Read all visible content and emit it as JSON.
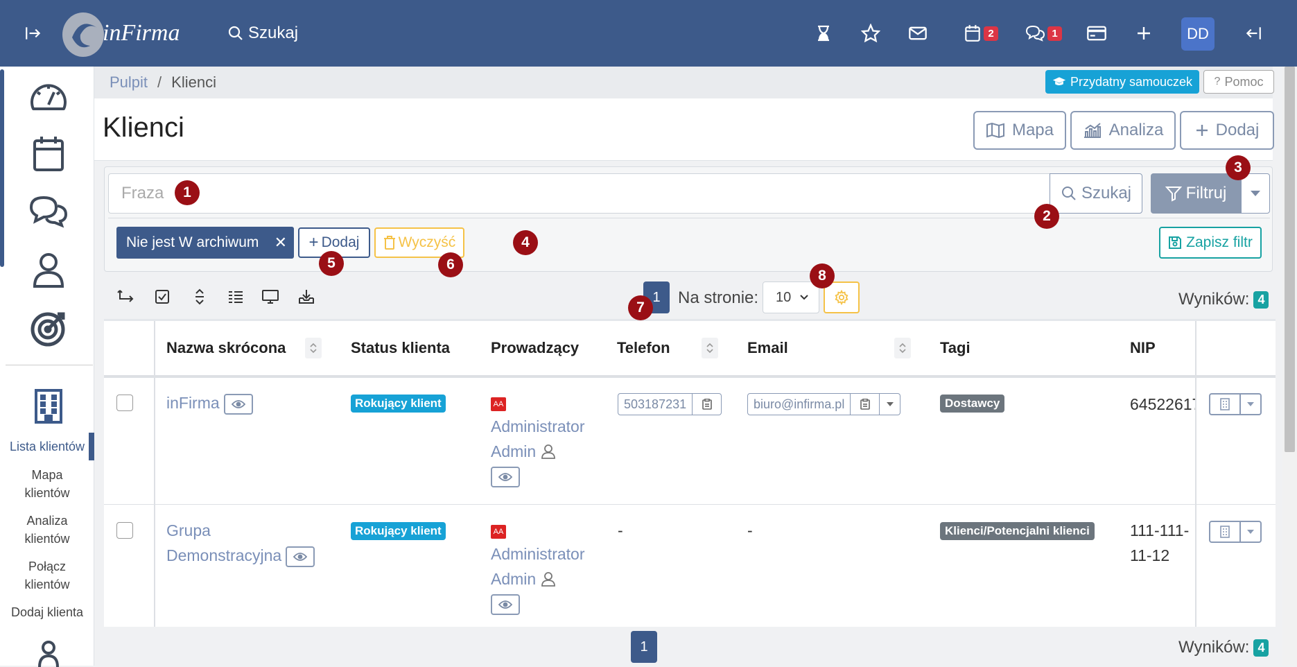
{
  "topbar": {
    "search_label": "Szukaj",
    "calendar_badge": "2",
    "chat_badge": "1",
    "avatar": "DD",
    "logo_text": "inFirma"
  },
  "sidebar": {
    "links": [
      "Lista klientów",
      "Mapa klientów",
      "Analiza klientów",
      "Połącz klientów",
      "Dodaj klienta"
    ],
    "link_lines": [
      [
        "Lista klientów"
      ],
      [
        "Mapa",
        "klientów"
      ],
      [
        "Analiza",
        "klientów"
      ],
      [
        "Połącz",
        "klientów"
      ],
      [
        "Dodaj klienta"
      ]
    ]
  },
  "breadcrumb": {
    "home": "Pulpit",
    "sep": "/",
    "current": "Klienci"
  },
  "help": {
    "tutorial": "Przydatny samouczek",
    "help": "Pomoc"
  },
  "page": {
    "title": "Klienci"
  },
  "header_buttons": {
    "map": "Mapa",
    "analysis": "Analiza",
    "add": "Dodaj"
  },
  "filter": {
    "phrase_placeholder": "Fraza",
    "search": "Szukaj",
    "filter": "Filtruj",
    "active_chip": "Nie jest W archiwum",
    "add": "Dodaj",
    "clear": "Wyczyść",
    "save": "Zapisz filtr"
  },
  "pagination": {
    "page": "1",
    "per_page_label": "Na stronie:",
    "per_page_value": "10",
    "results_label": "Wyników:",
    "results_count": "4"
  },
  "table": {
    "headers": [
      "Nazwa skrócona",
      "Status klienta",
      "Prowadzący",
      "Telefon",
      "Email",
      "Tagi",
      "NIP"
    ],
    "rows": [
      {
        "name": [
          "inFirma"
        ],
        "status": "Rokujący klient",
        "owner_badge": "AA",
        "owner": [
          "Administrator",
          "Admin"
        ],
        "phone": "503187231",
        "email": "biuro@infirma.pl",
        "tag": "Dostawcy",
        "nip": [
          "64522617"
        ]
      },
      {
        "name": [
          "Grupa",
          "Demonstracyjna"
        ],
        "status": "Rokujący klient",
        "owner_badge": "AA",
        "owner": [
          "Administrator",
          "Admin"
        ],
        "phone": "-",
        "email": "-",
        "tag": "Klienci/Potencjalni klienci",
        "nip": [
          "111-111-",
          "11-12"
        ]
      }
    ]
  },
  "markers": [
    "1",
    "2",
    "3",
    "4",
    "5",
    "6",
    "7",
    "8"
  ],
  "colors": {
    "primary": "#3d5a8a",
    "info": "#17a2d6",
    "warning": "#f5c247",
    "teal": "#17a2a2",
    "marker": "#9a0f15",
    "danger": "#dc3545"
  }
}
